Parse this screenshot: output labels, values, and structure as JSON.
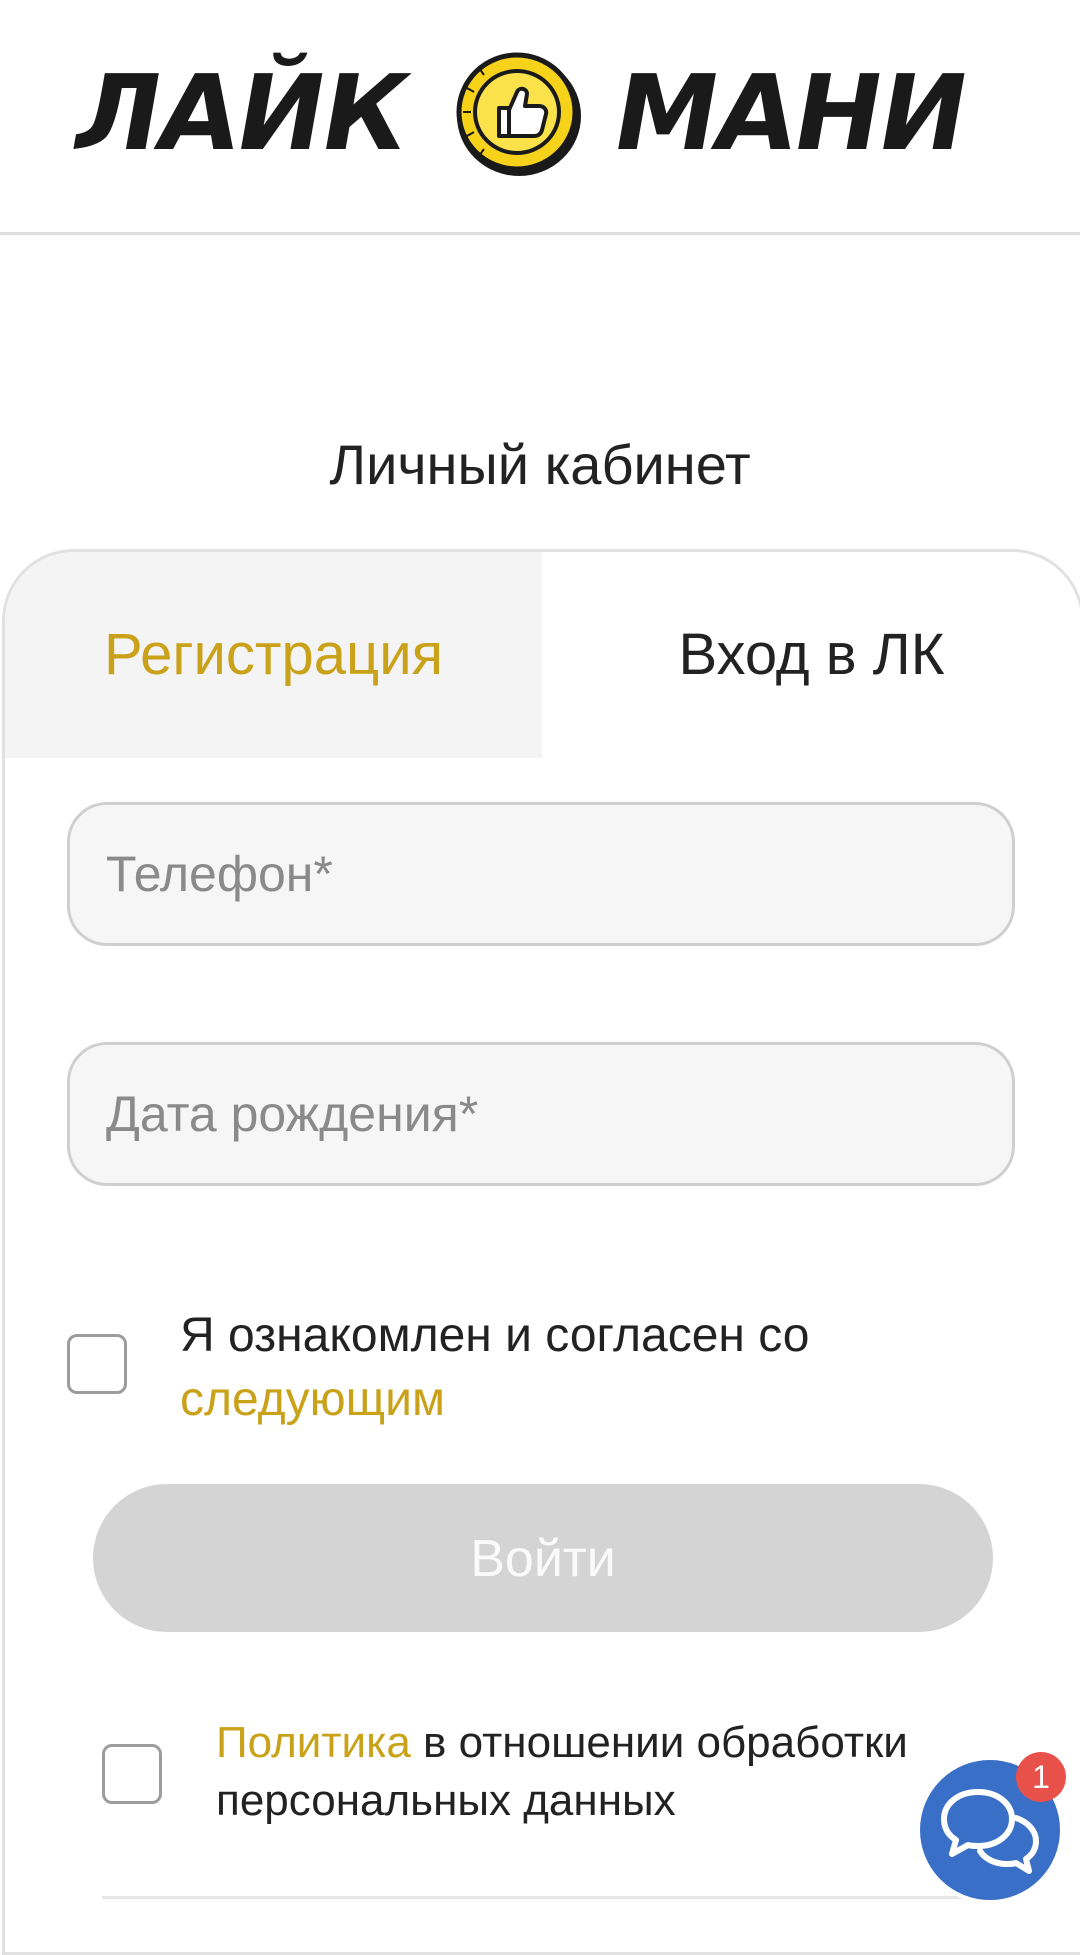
{
  "header": {
    "logo_left": "ЛАЙК",
    "logo_right": "МАНИ",
    "logo_colors": {
      "coin": "#f6d21a",
      "ink": "#1a1a1a"
    }
  },
  "page": {
    "title": "Личный кабинет"
  },
  "tabs": [
    {
      "label": "Регистрация",
      "active": false
    },
    {
      "label": "Вход в ЛК",
      "active": true
    }
  ],
  "form": {
    "phone": {
      "placeholder": "Телефон*",
      "value": ""
    },
    "birthdate": {
      "placeholder": "Дата рождения*",
      "value": ""
    },
    "agree": {
      "checked": false,
      "text": "Я ознакомлен и согласен со ",
      "link": "следующим"
    },
    "submit_label": "Войти",
    "policy": {
      "checked": false,
      "link": "Политика",
      "text": " в отношении обработки персональных данных"
    }
  },
  "chat": {
    "icon": "chat-bubbles-icon",
    "badge": "1"
  },
  "colors": {
    "accent": "#c9a21a",
    "button_disabled": "#d4d4d4",
    "chat": "#3a6fc7",
    "badge": "#e8504a"
  }
}
